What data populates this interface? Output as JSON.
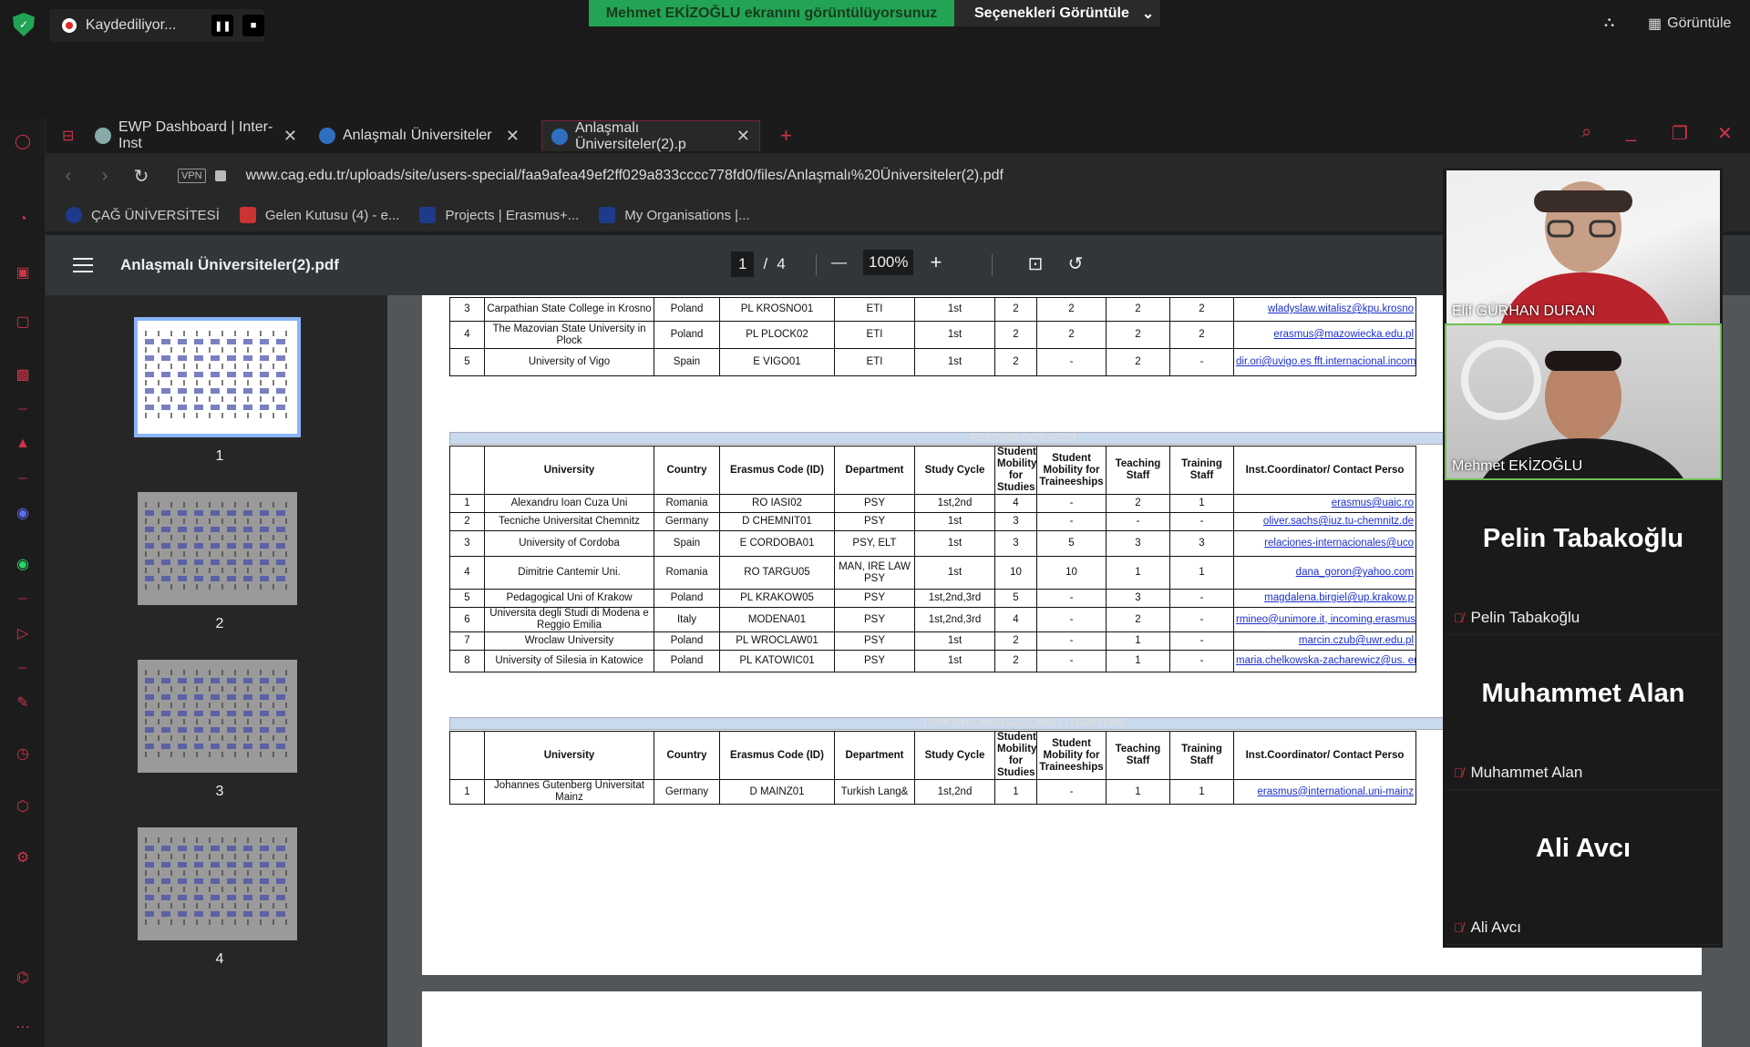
{
  "zoom": {
    "recording": "Kaydediliyor...",
    "share_banner": "Mehmet EKİZOĞLU ekranını görüntülüyorsunuz",
    "view_options": "Seçenekleri Görüntüle",
    "view_label": "Görüntüle"
  },
  "browser": {
    "tabs": [
      {
        "label": "EWP Dashboard | Inter-Inst"
      },
      {
        "label": "Anlaşmalı Üniversiteler"
      },
      {
        "label": "Anlaşmalı Üniversiteler(2).p"
      }
    ],
    "vpn": "VPN",
    "url": "www.cag.edu.tr/uploads/site/users-special/faa9afea49ef2ff029a833cccc778fd0/files/Anla%C5%9Fmal%C4%B1%20%C3%9Cniversiteler(2).pdf",
    "url_display": "www.cag.edu.tr/uploads/site/users-special/faa9afea49ef2ff029a833cccc778fd0/files/Anlaşmalı%20Üniversiteler(2).pdf",
    "bookmarks": [
      "ÇAĞ ÜNİVERSİTESİ",
      "Gelen Kutusu (4) - e...",
      "Projects | Erasmus+...",
      "My Organisations |..."
    ]
  },
  "pdf": {
    "filename": "Anlaşmalı Üniversiteler(2).pdf",
    "page_current": "1",
    "page_sep": "/",
    "page_total": "4",
    "zoom": "100%",
    "thumbnails": [
      "1",
      "2",
      "3",
      "4"
    ]
  },
  "table_top": [
    [
      "3",
      "Carpathian State College in Krosno",
      "Poland",
      "PL KROSNO01",
      "ETI",
      "1st",
      "2",
      "2",
      "2",
      "2",
      "wladyslaw.witalisz@kpu.krosno"
    ],
    [
      "4",
      "The Mazovian State University in Plock",
      "Poland",
      "PL PLOCK02",
      "ETI",
      "1st",
      "2",
      "2",
      "2",
      "2",
      "erasmus@mazowiecka.edu.pl"
    ],
    [
      "5",
      "University of Vigo",
      "Spain",
      "E VIGO01",
      "ETI",
      "1st",
      "2",
      "-",
      "2",
      "-",
      "dir.ori@uvigo.es fft.internacional.incoming@uvigo"
    ]
  ],
  "headers": [
    "",
    "University",
    "Country",
    "Erasmus Code (ID)",
    "Department",
    "Study Cycle",
    "Student Mobility for Studies",
    "Student Mobility for Traineeships",
    "Teaching Staff",
    "Training Staff",
    "Inst.Coordinator/ Contact Perso"
  ],
  "psy": {
    "title": "PSYCHOLOGY (PSY)",
    "rows": [
      [
        "1",
        "Alexandru Ioan Cuza Uni",
        "Romania",
        "RO IASI02",
        "PSY",
        "1st,2nd",
        "4",
        "-",
        "2",
        "1",
        "erasmus@uaic.ro"
      ],
      [
        "2",
        "Tecniche Universitat Chemnitz",
        "Germany",
        "D CHEMNIT01",
        "PSY",
        "1st",
        "3",
        "-",
        "-",
        "-",
        "oliver.sachs@iuz.tu-chemnitz.de"
      ],
      [
        "3",
        "University of Cordoba",
        "Spain",
        "E CORDOBA01",
        "PSY, ELT",
        "1st",
        "3",
        "5",
        "3",
        "3",
        "relaciones-internacionales@uco"
      ],
      [
        "4",
        "Dimitrie Cantemir Uni.",
        "Romania",
        "RO TARGU05",
        "MAN, IRE LAW PSY",
        "1st",
        "10",
        "10",
        "1",
        "1",
        "dana_goron@yahoo.com"
      ],
      [
        "5",
        "Pedagogical Uni of Krakow",
        "Poland",
        "PL KRAKOW05",
        "PSY",
        "1st,2nd,3rd",
        "5",
        "-",
        "3",
        "-",
        "magdalena.birgiel@up.krakow.p"
      ],
      [
        "6",
        "Universita degli Studi di Modena e Reggio Emilia",
        "Italy",
        "MODENA01",
        "PSY",
        "1st,2nd,3rd",
        "4",
        "-",
        "2",
        "-",
        "rmineo@unimore.it, incoming.erasmus@unimore.it"
      ],
      [
        "7",
        "Wroclaw University",
        "Poland",
        "PL WROCLAW01",
        "PSY",
        "1st",
        "2",
        "-",
        "1",
        "-",
        "marcin.czub@uwr.edu.pl"
      ],
      [
        "8",
        "University of Silesia in Katowice",
        "Poland",
        "PL KATOWIC01",
        "PSY",
        "1st",
        "2",
        "-",
        "1",
        "-",
        "maria.chelkowska-zacharewicz@us. erasmus@us.edu.pl"
      ]
    ]
  },
  "tll": {
    "title": "TURKISH LANGUAGE AND LITERATURE",
    "rows": [
      [
        "1",
        "Johannes Gutenberg Universitat Mainz",
        "Germany",
        "D MAINZ01",
        "Turkish Lang&",
        "1st,2nd",
        "1",
        "-",
        "1",
        "1",
        "erasmus@international.uni-mainz"
      ]
    ]
  },
  "participants": {
    "video1": "Elif GÜRHAN DURAN",
    "video2": "Mehmet EKİZOĞLU",
    "tiles": [
      "Pelin Tabakoğlu",
      "Muhammet Alan",
      "Ali Avcı"
    ]
  }
}
